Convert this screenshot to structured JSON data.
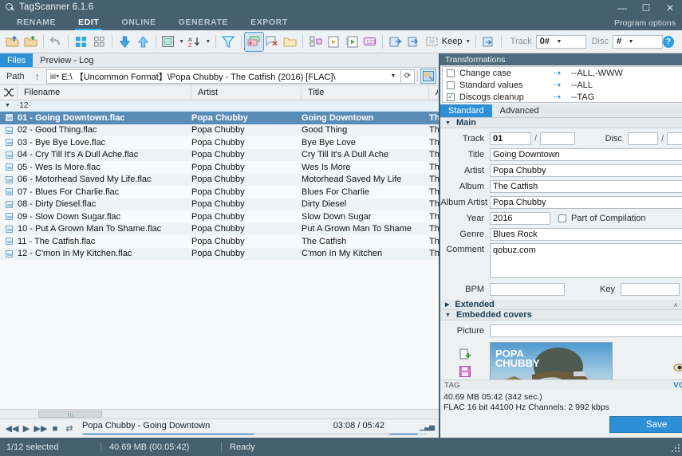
{
  "window": {
    "title": "TagScanner 6.1.6",
    "logo_icon": "magnifier-icon",
    "minimize": "—",
    "maximize": "☐",
    "close": "✕"
  },
  "menu": {
    "tabs": [
      {
        "label": "RENAME",
        "active": false
      },
      {
        "label": "EDIT",
        "active": true
      },
      {
        "label": "ONLINE",
        "active": false
      },
      {
        "label": "GENERATE",
        "active": false
      },
      {
        "label": "EXPORT",
        "active": false
      }
    ],
    "program_options": "Program options"
  },
  "toolbar": {
    "keep_label": "Keep",
    "track_label": "Track",
    "track_value": "0#",
    "disc_label": "Disc",
    "disc_value": "#",
    "help_label": "?",
    "icons": [
      "add-folder-icon",
      "add-files-icon",
      "undo-icon",
      "select-all-icon",
      "select-none-icon",
      "move-down-icon",
      "move-up-icon",
      "view-mode-icon",
      "sort-az-icon",
      "filter-icon",
      "tag-from-filename-icon",
      "clear-tag-icon",
      "folder-icon",
      "playlist-icon",
      "file-export-icon",
      "file-import-icon",
      "autonumber-icon",
      "import-tags-icon",
      "export-tags-icon",
      "rename-icon"
    ]
  },
  "files_panel": {
    "tabs": [
      {
        "label": "Files",
        "active": true
      },
      {
        "label": "Preview - Log",
        "active": false
      }
    ],
    "path_label": "Path",
    "path_value": "E:\\ 【Uncommon Format】\\Popa Chubby - The Catfish (2016) [FLAC]\\",
    "up_icon": "arrow-up-icon",
    "refresh_icon": "refresh-icon",
    "preview_icon": "preview-pane-icon",
    "columns": [
      "Filename",
      "Artist",
      "Title",
      "Alb"
    ],
    "shuffle_icon": "shuffle-icon",
    "group_count": "12",
    "rows": [
      {
        "filename": "01 - Going Downtown.flac",
        "artist": "Popa Chubby",
        "title": "Going Downtown",
        "album": "The",
        "selected": true
      },
      {
        "filename": "02 - Good Thing.flac",
        "artist": "Popa Chubby",
        "title": "Good Thing",
        "album": "The",
        "selected": false
      },
      {
        "filename": "03 - Bye Bye Love.flac",
        "artist": "Popa Chubby",
        "title": "Bye Bye Love",
        "album": "The",
        "selected": false
      },
      {
        "filename": "04 - Cry Till It's A Dull Ache.flac",
        "artist": "Popa Chubby",
        "title": "Cry Till It's A Dull Ache",
        "album": "The",
        "selected": false
      },
      {
        "filename": "05 - Wes Is More.flac",
        "artist": "Popa Chubby",
        "title": "Wes Is More",
        "album": "The",
        "selected": false
      },
      {
        "filename": "06 - Motorhead Saved My Life.flac",
        "artist": "Popa Chubby",
        "title": "Motorhead Saved My Life",
        "album": "The",
        "selected": false
      },
      {
        "filename": "07 - Blues For Charlie.flac",
        "artist": "Popa Chubby",
        "title": "Blues For Charlie",
        "album": "The",
        "selected": false
      },
      {
        "filename": "08 - Dirty Diesel.flac",
        "artist": "Popa Chubby",
        "title": "Dirty Diesel",
        "album": "The",
        "selected": false
      },
      {
        "filename": "09 - Slow Down Sugar.flac",
        "artist": "Popa Chubby",
        "title": "Slow Down Sugar",
        "album": "The",
        "selected": false
      },
      {
        "filename": "10 - Put A Grown Man To Shame.flac",
        "artist": "Popa Chubby",
        "title": "Put A Grown Man To Shame",
        "album": "The",
        "selected": false
      },
      {
        "filename": "11 - The Catfish.flac",
        "artist": "Popa Chubby",
        "title": "The Catfish",
        "album": "The",
        "selected": false
      },
      {
        "filename": "12 - C'mon In My Kitchen.flac",
        "artist": "Popa Chubby",
        "title": "C'mon In My Kitchen",
        "album": "The",
        "selected": false
      }
    ]
  },
  "player": {
    "prev_icon": "rewind-icon",
    "play_icon": "play-icon",
    "next_icon": "fast-forward-icon",
    "stop_icon": "stop-icon",
    "repeat_icon": "repeat-icon",
    "now_playing": "Popa Chubby - Going Downtown",
    "time": "03:08 / 05:42",
    "progress_percent": 56,
    "volume_percent": 80,
    "volume_icon": "volume-bars-icon"
  },
  "transformations": {
    "title": "Transformations",
    "menu_icon": "ellipsis-icon",
    "items": [
      {
        "label": "Change case",
        "checked": false,
        "arrow": "⇢",
        "value": "--ALL,-WWW"
      },
      {
        "label": "Standard values",
        "checked": false,
        "arrow": "⇢",
        "value": "--ALL"
      },
      {
        "label": "Discogs cleanup",
        "checked": true,
        "arrow": "⇢",
        "value": "--TAG"
      }
    ]
  },
  "tag_editor": {
    "tabs": [
      {
        "label": "Standard",
        "active": true
      },
      {
        "label": "Advanced",
        "active": false
      }
    ],
    "sections": {
      "main": {
        "label": "Main",
        "expanded": true
      },
      "extended": {
        "label": "Extended",
        "expanded": false
      },
      "covers": {
        "label": "Embedded covers",
        "expanded": true
      }
    },
    "fields": {
      "track_label": "Track",
      "track_value": "01",
      "track_total": "",
      "disc_label": "Disc",
      "disc_value": "",
      "disc_total": "",
      "title_label": "Title",
      "title_value": "Going Downtown",
      "artist_label": "Artist",
      "artist_value": "Popa Chubby",
      "album_label": "Album",
      "album_value": "The Catfish",
      "album_artist_label": "Album Artist",
      "album_artist_value": "Popa Chubby",
      "year_label": "Year",
      "year_value": "2016",
      "compilation_label": "Part of Compilation",
      "compilation_checked": false,
      "genre_label": "Genre",
      "genre_value": "Blues Rock",
      "comment_label": "Comment",
      "comment_value": "qobuz.com",
      "bpm_label": "BPM",
      "bpm_value": "",
      "key_label": "Key",
      "key_value": ""
    },
    "picture_label": "Picture",
    "picture_value": "",
    "cover_text_line1": "POPA",
    "cover_text_line2": "CHUBBY",
    "cover_tools": [
      "add-cover-icon",
      "save-cover-icon",
      "delete-cover-icon"
    ],
    "preview_eye_icon": "eye-icon",
    "tag_footer_label": "TAG",
    "tag_format": "VORBIS",
    "file_info_line1": "40.69 MB  05:42 (342 sec.)",
    "file_info_line2": "FLAC  16 bit  44100 Hz  Channels: 2  992 kbps",
    "save_label": "Save"
  },
  "statusbar": {
    "selection": "1/12 selected",
    "size": "40.69 MB (00:05:42)",
    "state": "Ready"
  }
}
